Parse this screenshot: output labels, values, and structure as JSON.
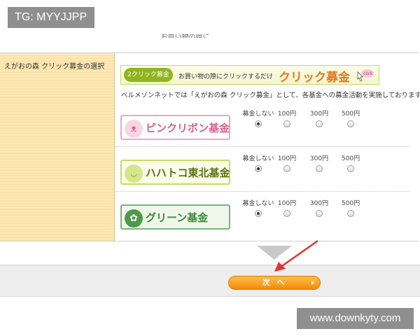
{
  "overlay": {
    "tg_label": "TG: MYYJJPP",
    "watermark": "www.downkyty.com"
  },
  "top_cut_text": "...お買い物の際に...",
  "form": {
    "row_label": "えがおの森 クリック募金の選択",
    "banner": {
      "badge": "2クリック募金",
      "subtitle": "お買い物の際にクリックするだけ",
      "title": "クリック募金",
      "click_tag": "click"
    },
    "description": "ベルメゾンネットでは「えがおの森 クリック募金」として、各基金への募金活動を実施しております。",
    "options": [
      "募金しない",
      "100円",
      "300円",
      "500円"
    ],
    "funds": [
      {
        "name": "ピンクリボン基金",
        "icon": "pink-ribbon-icon",
        "mark": "ᴥ",
        "selected": "募金しない"
      },
      {
        "name": "ハハトコ東北基金",
        "icon": "smile-face-icon",
        "mark": "◡",
        "selected": "募金しない"
      },
      {
        "name": "グリーン基金",
        "icon": "tree-icon",
        "mark": "✿",
        "selected": "募金しない"
      }
    ]
  },
  "footer": {
    "next_label": "次 へ"
  },
  "colors": {
    "label_cell": "#fde9b8",
    "next_button": "#f18a0e",
    "annotation_arrow": "#e0332f"
  }
}
